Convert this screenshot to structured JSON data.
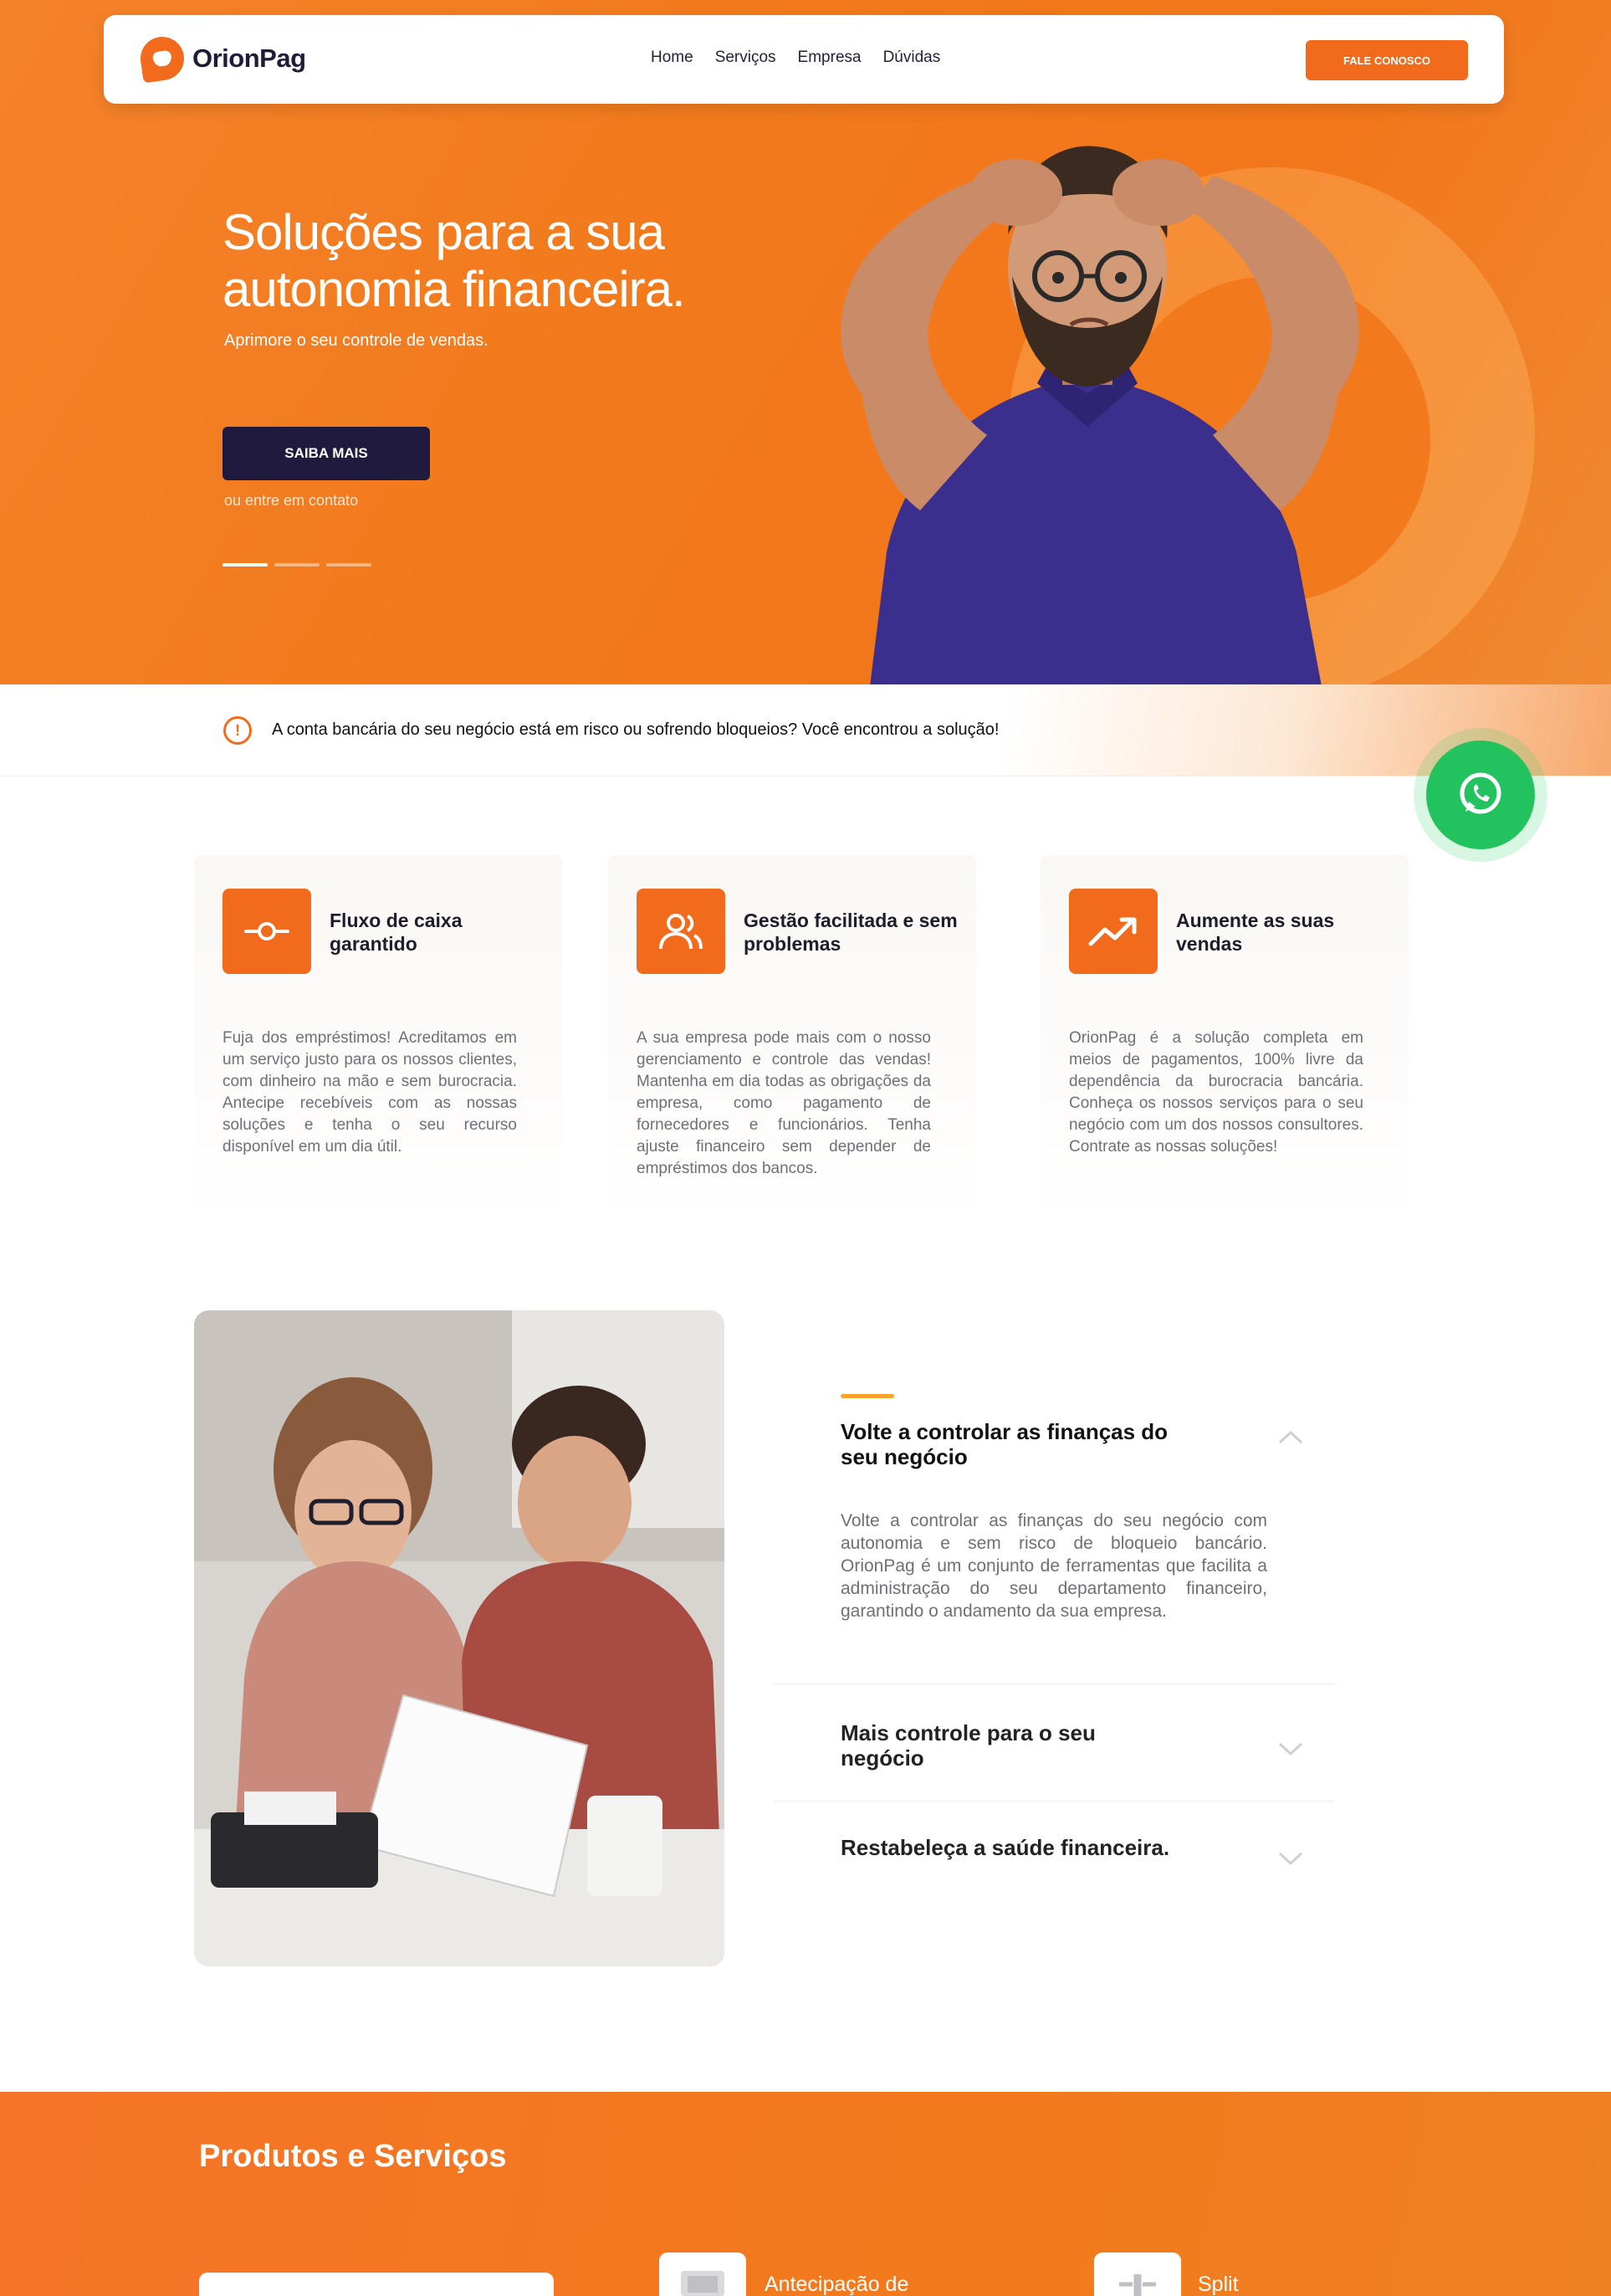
{
  "nav": {
    "brand": "OrionPag",
    "links": [
      "Home",
      "Serviços",
      "Empresa",
      "Dúvidas"
    ],
    "cta": "FALE CONOSCO"
  },
  "hero": {
    "title_line1": "Soluções para a sua",
    "title_line2": "autonomia financeira.",
    "subtitle": "Aprimore o seu controle de vendas.",
    "button": "SAIBA MAIS",
    "contact_link": "ou entre em contato",
    "slides": 3,
    "active_slide": 1
  },
  "alert": {
    "text": "A conta bancária do seu negócio está em risco ou sofrendo bloqueios? Você encontrou a solução!"
  },
  "features": [
    {
      "title": "Fluxo de caixa garantido",
      "icon": "cash-flow-icon",
      "text": "Fuja dos empréstimos! Acreditamos em um serviço justo para os nossos clientes, com dinheiro na mão e sem burocracia. Antecipe recebíveis com as nossas soluções e tenha o seu recurso disponível em um dia útil."
    },
    {
      "title": "Gestão facilitada e sem problemas",
      "icon": "users-icon",
      "text": "A sua empresa pode mais com o nosso gerenciamento e controle das vendas! Mantenha em dia todas as obrigações da empresa, como pagamento de fornecedores e funcionários. Tenha ajuste financeiro sem depender de empréstimos dos bancos."
    },
    {
      "title": "Aumente as suas vendas",
      "icon": "trending-up-icon",
      "text": "OrionPag é a solução completa em meios de pagamentos, 100% livre da dependência da burocracia bancária. Conheça os nossos serviços para o seu negócio com um dos nossos consultores. Contrate as nossas soluções!"
    }
  ],
  "faq": {
    "items": [
      {
        "title": "Volte a controlar as finanças do seu negócio",
        "body": "Volte a controlar as finanças do seu negócio com autonomia e sem risco de bloqueio bancário. OrionPag é um conjunto de ferramentas que facilita a administração do seu departamento financeiro, garantindo o andamento da sua empresa.",
        "expanded": true
      },
      {
        "title": "Mais controle para o seu negócio",
        "expanded": false
      },
      {
        "title": "Restabeleça a saúde financeira.",
        "expanded": false
      }
    ]
  },
  "products": {
    "title": "Produtos e Serviços",
    "items": [
      "Antecipação de",
      "Split"
    ]
  },
  "colors": {
    "brand_orange": "#f26b1d",
    "navy": "#201a3f",
    "whatsapp_green": "#22c35e"
  }
}
